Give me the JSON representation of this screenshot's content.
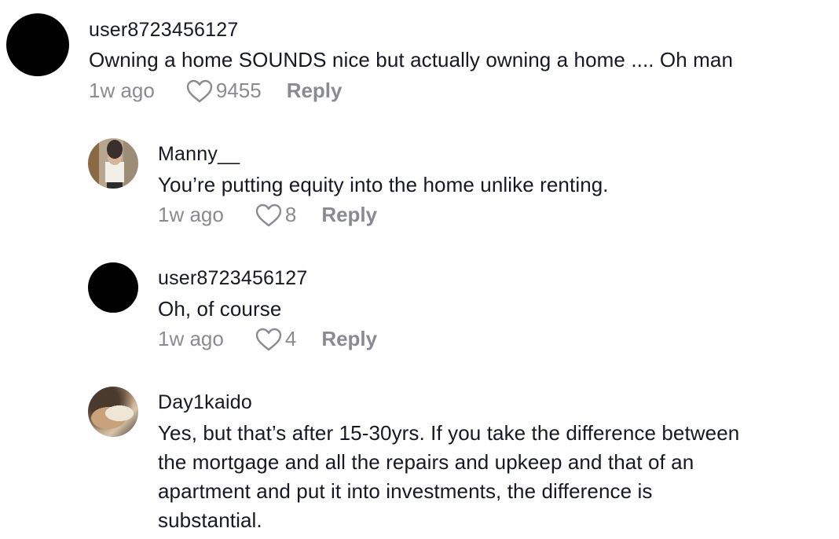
{
  "comments": [
    {
      "username": "user8723456127",
      "text": "Owning a home SOUNDS nice but actually owning a home .... Oh man",
      "time": "1w ago",
      "likes": "9455",
      "reply_label": "Reply",
      "avatar": "black-circle"
    },
    {
      "username": "Manny__",
      "text": "You’re putting equity into the home unlike renting.",
      "time": "1w ago",
      "likes": "8",
      "reply_label": "Reply",
      "avatar": "photo"
    },
    {
      "username": "user8723456127",
      "text": "Oh, of course",
      "time": "1w ago",
      "likes": "4",
      "reply_label": "Reply",
      "avatar": "black-circle"
    },
    {
      "username": "Day1kaido",
      "text_lines": [
        "Yes, but that’s after 15-30yrs. If you take the difference between",
        "the mortgage and all the repairs and upkeep and that of an",
        "apartment and put it into investments, the difference is",
        "substantial."
      ],
      "avatar": "photo"
    }
  ],
  "icons": {
    "like": "heart-outline-icon"
  },
  "colors": {
    "text": "#161823",
    "secondary": "#8a8b91"
  }
}
